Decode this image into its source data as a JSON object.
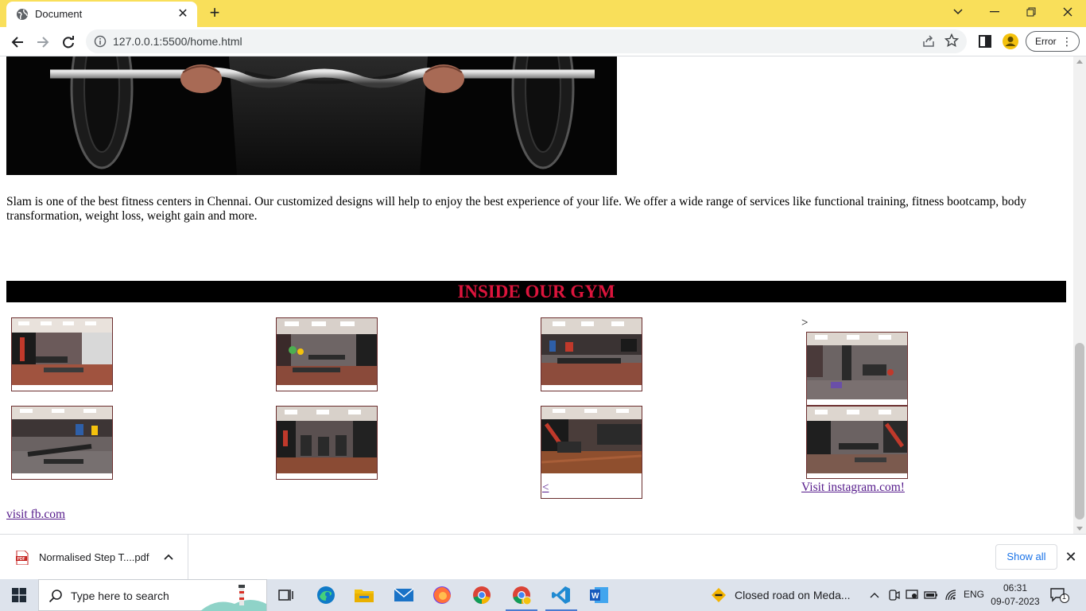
{
  "browser": {
    "tab_title": "Document",
    "url": "127.0.0.1:5500/home.html",
    "profile_button": "Error"
  },
  "page": {
    "intro_text": "Slam is one of the best fitness centers in Chennai. Our customized designs will help to enjoy the best experience of your life. We offer a wide range of services like functional training, fitness bootcamp, body transformation, weight loss, weight gain and more.",
    "gym_heading": "INSIDE OUR GYM",
    "gt_symbol": ">",
    "lt_link": "<",
    "instagram_link": "Visit instagram.com!",
    "fb_link": "visit fb.com",
    "colors": {
      "heading_text": "#dc143c",
      "heading_bg": "#000000",
      "link_visited": "#551a8b"
    }
  },
  "downloads": {
    "file_name": "Normalised Step T....pdf",
    "show_all": "Show all"
  },
  "taskbar": {
    "search_placeholder": "Type here to search",
    "weather_text": "Closed road on Meda...",
    "language": "ENG",
    "time": "06:31",
    "date": "09-07-2023",
    "notification_count": "1"
  }
}
